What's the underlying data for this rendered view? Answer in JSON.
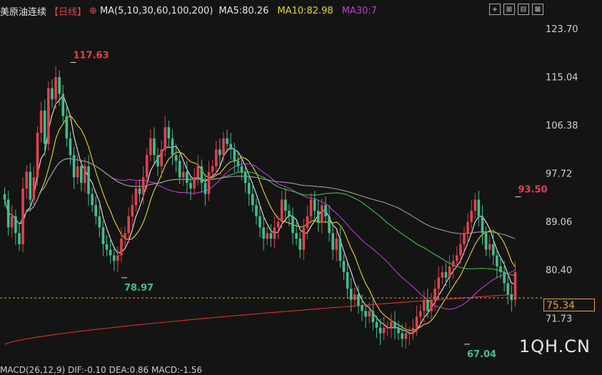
{
  "header": {
    "symbol": "美原油连续",
    "period": "【日线】",
    "ma_params": "MA(5,10,30,60,100,200)",
    "ma5": "MA5:80.26",
    "ma10": "MA10:82.98",
    "ma30": "MA30:7"
  },
  "toolbar": [
    "+",
    "⊞",
    "⊟",
    "⊠"
  ],
  "watermark": "1QH.CN",
  "current_price": "75.34",
  "macd_line": "MACD(26,12,9) DIF:-0.10 DEA:0.86 MACD:-1.56",
  "colors": {
    "up": "#e0424d",
    "down": "#3ebf8f",
    "ma5": "#e9e9e9",
    "ma10": "#e5d531",
    "ma30": "#c13ad6",
    "ma60": "#3ec23e",
    "ma100": "#9a9a9a",
    "ma200": "#d8322f",
    "price_line": "#e2a33c"
  },
  "chart_data": {
    "type": "candlestick",
    "y_ticks": [
      "123.70",
      "115.04",
      "106.38",
      "97.72",
      "89.06",
      "80.40",
      "71.73"
    ],
    "ylim": [
      66,
      125
    ],
    "annotations": [
      {
        "label": "117.63",
        "value": 117.63,
        "color": "up",
        "bar": 18
      },
      {
        "label": "78.97",
        "value": 78.97,
        "color": "down",
        "bar": 32
      },
      {
        "label": "93.50",
        "value": 93.5,
        "color": "up",
        "bar": 153
      },
      {
        "label": "67.04",
        "value": 67.04,
        "color": "down",
        "bar": 126
      }
    ],
    "last_price": 75.34,
    "closes": [
      93,
      88,
      90,
      87,
      85,
      95,
      98,
      93,
      97,
      105,
      109,
      103,
      113,
      111,
      115,
      112,
      108,
      104,
      101,
      97,
      99,
      96,
      99,
      94,
      92,
      90,
      88,
      85,
      84,
      83,
      82,
      83,
      86,
      87,
      90,
      92,
      95,
      94,
      97,
      101,
      104,
      101,
      99,
      102,
      106,
      104,
      101,
      100,
      97,
      98,
      96,
      95,
      97,
      99,
      96,
      94,
      98,
      99,
      102,
      101,
      104,
      103,
      102,
      100,
      99,
      98,
      96,
      94,
      92,
      90,
      88,
      86,
      87,
      86,
      88,
      89,
      93,
      91,
      90,
      87,
      86,
      84,
      88,
      90,
      93,
      91,
      89,
      92,
      90,
      87,
      84,
      86,
      82,
      80,
      77,
      75,
      76,
      74,
      73,
      72,
      73,
      71,
      70,
      69,
      70,
      70,
      71,
      70,
      69,
      68,
      69,
      69,
      70,
      72,
      73,
      75,
      73,
      75,
      77,
      79,
      80,
      79,
      81,
      82,
      83,
      85,
      87,
      89,
      91,
      93,
      90,
      87,
      84,
      85,
      83,
      81,
      80,
      78,
      76,
      75,
      80
    ]
  }
}
